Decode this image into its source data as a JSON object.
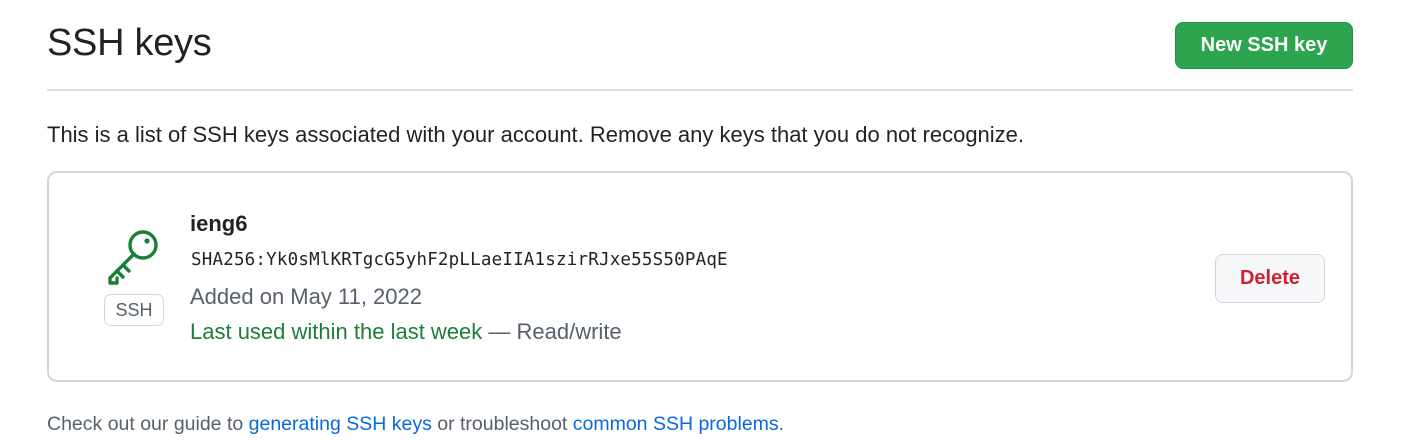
{
  "header": {
    "title": "SSH keys",
    "new_key_label": "New SSH key"
  },
  "intro_text": "This is a list of SSH keys associated with your account. Remove any keys that you do not recognize.",
  "keys": [
    {
      "title": "ieng6",
      "fingerprint": "SHA256:Yk0sMlKRTgcG5yhF2pLLaeIIA1szirRJxe55S50PAqE",
      "added_on": "Added on May 11, 2022",
      "last_used": "Last used within the last week",
      "access": " — Read/write",
      "badge": "SSH",
      "icon": "key-icon",
      "delete_label": "Delete"
    }
  ],
  "footer": {
    "prefix": "Check out our guide to ",
    "link1": "generating SSH keys",
    "middle": " or troubleshoot ",
    "link2": "common SSH problems",
    "suffix": "."
  },
  "colors": {
    "primary_button": "#2da44e",
    "danger_text": "#cf222e",
    "success_text": "#1a7f37",
    "link": "#0969da",
    "muted_text": "#57606a"
  }
}
